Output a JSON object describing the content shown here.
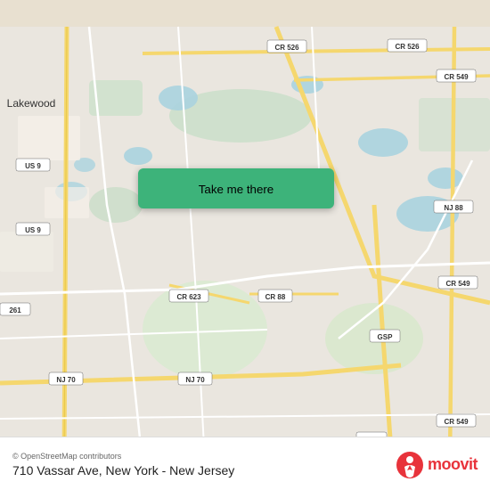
{
  "map": {
    "alt": "Map of Lakewood NJ area showing 710 Vassar Ave",
    "center_lat": 40.08,
    "center_lng": -74.18
  },
  "button": {
    "label": "Take me there",
    "icon": "location-pin"
  },
  "info_bar": {
    "osm_credit": "© OpenStreetMap contributors",
    "address": "710 Vassar Ave, New York - New Jersey",
    "moovit_label": "moovit"
  },
  "colors": {
    "button_green": "#3db37a",
    "road_yellow": "#f5d76e",
    "road_white": "#ffffff",
    "water_blue": "#aad3df",
    "land_green": "#c8e6c0",
    "map_bg": "#eae6df"
  }
}
